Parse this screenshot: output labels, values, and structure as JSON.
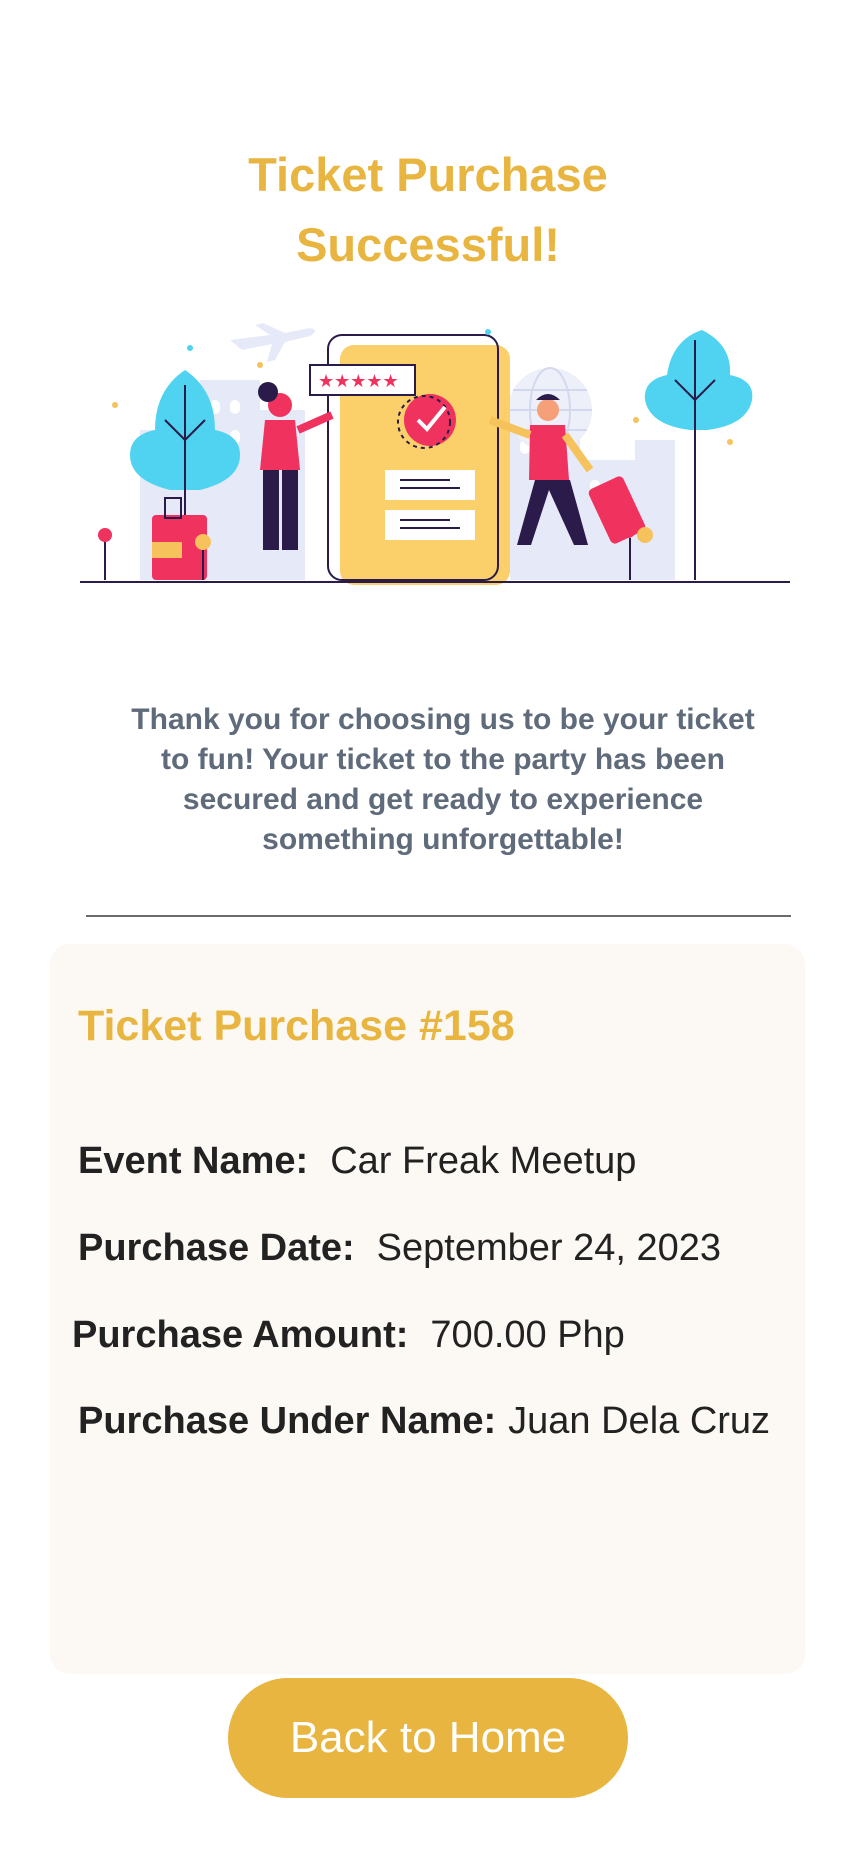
{
  "header": {
    "title_line1": "Ticket Purchase",
    "title_line2": "Successful!"
  },
  "illustration": {
    "icon": "ticket-purchase-illustration-icon",
    "rating_stars": 5
  },
  "message": {
    "line1": "Thank you for choosing us to be your ticket",
    "line2": "to fun! Your ticket to the party has been",
    "line3": "secured and get ready to experience",
    "line4": "something unforgettable!"
  },
  "ticket": {
    "title": "Ticket Purchase #158",
    "fields": [
      {
        "label": "Event Name:",
        "value": "Car Freak Meetup"
      },
      {
        "label": "Purchase Date:",
        "value": "September 24, 2023"
      },
      {
        "label": "Purchase Amount:",
        "value": "700.00 Php"
      },
      {
        "label": "Purchase Under Name:",
        "value": "Juan Dela Cruz"
      }
    ]
  },
  "actions": {
    "back_home_label": "Back to Home"
  },
  "colors": {
    "accent": "#E8B540",
    "text_muted": "#5F6B7A",
    "card_bg": "#FCF9F4",
    "illustration_pink": "#F0335E",
    "illustration_blue": "#4FD3F0",
    "illustration_dark": "#2A1B4A"
  }
}
